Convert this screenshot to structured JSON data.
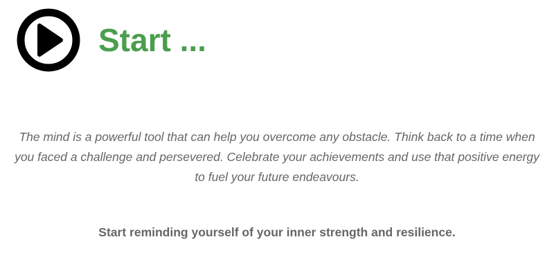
{
  "header": {
    "icon": "play-icon",
    "title": "Start ...",
    "title_color": "#4a9e4e"
  },
  "content": {
    "message": "The mind is a powerful tool that can help you overcome any obstacle. Think back to a time when you faced a challenge and persevered. Celebrate your achievements and use that positive energy to fuel your future endeavours.",
    "tagline": "Start reminding yourself of your inner strength and resilience.",
    "text_color": "#666666"
  }
}
